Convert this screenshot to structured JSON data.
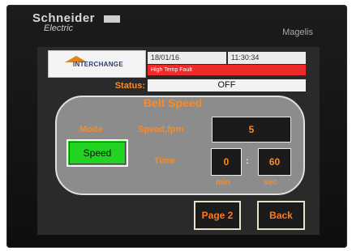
{
  "bezel": {
    "brand_name": "Schneider",
    "brand_sub": "Electric",
    "model": "Magelis"
  },
  "header": {
    "logo_text": "INTERCHANGE",
    "date": "18/01/16",
    "time": "11:30:34",
    "alarm": "High Temp Fault"
  },
  "status": {
    "label": "Status:",
    "value": "OFF"
  },
  "panel": {
    "title": "Belt Speed",
    "mode_label": "Mode",
    "mode_button": "Speed",
    "speed_label": "Speed,fpm",
    "speed_value": "5",
    "time_label": "Time",
    "time_min_value": "0",
    "time_sec_value": "60",
    "time_separator": ":",
    "min_unit": "min",
    "sec_unit": "sec"
  },
  "nav": {
    "page2": "Page 2",
    "back": "Back"
  },
  "colors": {
    "accent_orange": "#ff8a1e",
    "mode_green": "#22d322",
    "alarm_red": "#ee2a2a",
    "panel_gray": "#8c8c8c"
  }
}
